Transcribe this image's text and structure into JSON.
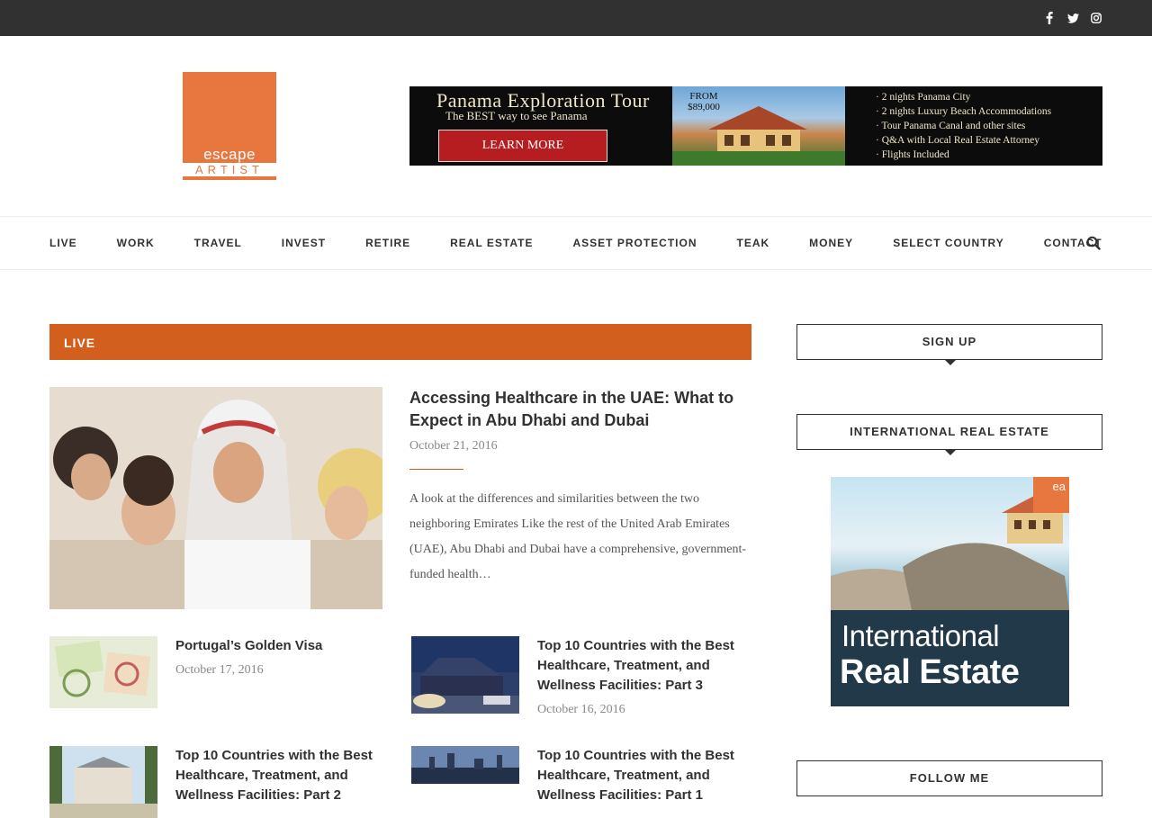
{
  "topbar": {
    "social": [
      "facebook-icon",
      "twitter-icon",
      "instagram-icon"
    ]
  },
  "logo": {
    "line1": "escape",
    "line2": "ARTIST",
    "color": "#e8773f"
  },
  "banner": {
    "title": "Panama Exploration Tour",
    "subtitle": "The BEST way to see Panama",
    "button": "LEARN MORE",
    "from_label": "FROM",
    "price": "$89,000",
    "features": [
      "· 2 nights Panama City",
      "· 2 nights Luxury Beach Accommodations",
      "· Tour Panama Canal and other sites",
      "· Q&A with Local Real Estate Attorney",
      "· Flights Included"
    ]
  },
  "nav": {
    "items": [
      "LIVE",
      "WORK",
      "TRAVEL",
      "INVEST",
      "RETIRE",
      "REAL ESTATE",
      "ASSET PROTECTION",
      "TEAK",
      "MONEY",
      "SELECT COUNTRY",
      "CONTACT"
    ]
  },
  "category": {
    "label": "LIVE",
    "color": "#d35f1f"
  },
  "featured": {
    "title": "Accessing Healthcare in the UAE: What to Expect in Abu Dhabi and Dubai",
    "date": "October 21, 2016",
    "excerpt": "A look at the differences and similarities between the two neighboring Emirates Like the rest of the United Arab Emirates (UAE), Abu Dhabi and Dubai have a comprehensive, government-funded health…"
  },
  "posts": [
    {
      "title": "Portugal’s Golden Visa",
      "date": "October 17, 2016"
    },
    {
      "title": "Top 10 Countries with the Best Healthcare, Treatment, and Wellness Facilities: Part 3",
      "date": "October 16, 2016"
    },
    {
      "title": "Top 10 Countries with the Best Healthcare, Treatment, and Wellness Facilities: Part 2",
      "date": ""
    },
    {
      "title": "Top 10 Countries with the Best Healthcare, Treatment, and Wellness Facilities: Part 1",
      "date": ""
    }
  ],
  "sidebar": {
    "signup_title": "SIGN UP",
    "ire_title": "INTERNATIONAL REAL ESTATE",
    "ire_ad": {
      "badge": "ea",
      "line1": "International",
      "line2": "Real Estate"
    },
    "follow_title": "FOLLOW ME"
  }
}
